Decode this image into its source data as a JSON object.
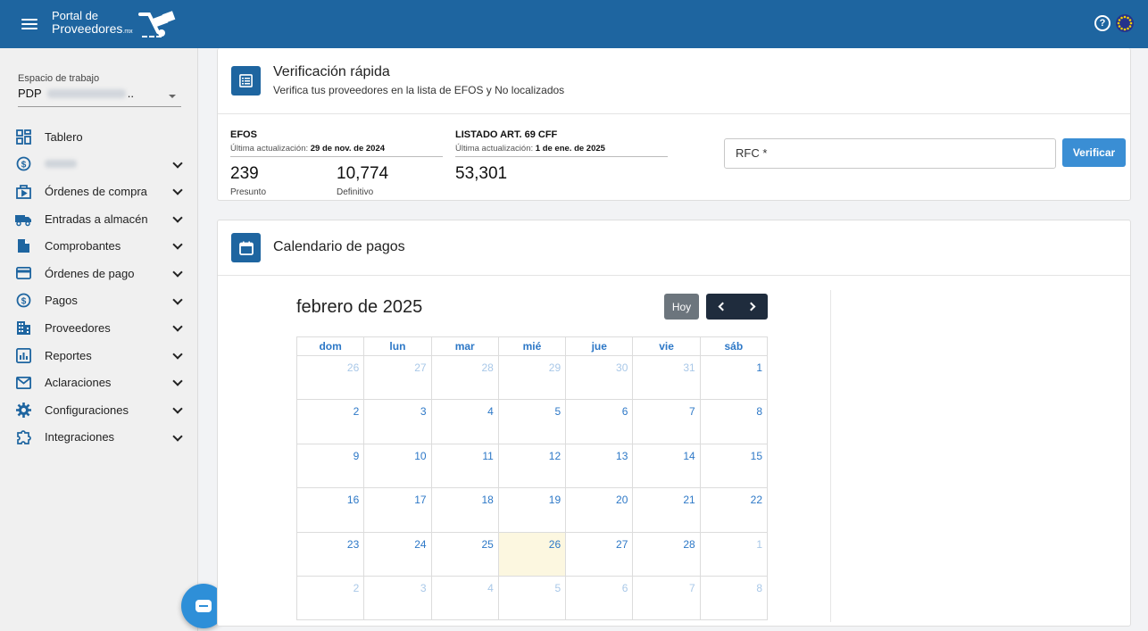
{
  "header": {
    "brand_line1": "Portal de",
    "brand_line2": "Proveedores",
    "brand_suffix": ".mx",
    "help_label": "?"
  },
  "sidebar": {
    "workspace_label": "Espacio de trabajo",
    "workspace_prefix": "PDP",
    "workspace_suffix": "..",
    "items": [
      {
        "label": "Tablero",
        "icon": "dashboard-icon",
        "chevron": false
      },
      {
        "label": "",
        "icon": "dollar-circle-icon",
        "chevron": true,
        "blurred": true
      },
      {
        "label": "Órdenes de compra",
        "icon": "purchase-order-icon",
        "chevron": true
      },
      {
        "label": "Entradas a almacén",
        "icon": "truck-icon",
        "chevron": true
      },
      {
        "label": "Comprobantes",
        "icon": "document-icon",
        "chevron": true
      },
      {
        "label": "Órdenes de pago",
        "icon": "credit-card-icon",
        "chevron": true
      },
      {
        "label": "Pagos",
        "icon": "dollar-circle-icon",
        "chevron": true
      },
      {
        "label": "Proveedores",
        "icon": "building-icon",
        "chevron": true
      },
      {
        "label": "Reportes",
        "icon": "bar-chart-icon",
        "chevron": true
      },
      {
        "label": "Aclaraciones",
        "icon": "envelope-icon",
        "chevron": true
      },
      {
        "label": "Configuraciones",
        "icon": "gear-icon",
        "chevron": true
      },
      {
        "label": "Integraciones",
        "icon": "puzzle-icon",
        "chevron": true
      }
    ]
  },
  "verification": {
    "title": "Verificación rápida",
    "subtitle": "Verifica tus proveedores en la lista de EFOS y No localizados",
    "efos": {
      "title": "EFOS",
      "update_label": "Última actualización:",
      "update_date": "29 de nov. de 2024",
      "presunto_value": "239",
      "presunto_label": "Presunto",
      "definitivo_value": "10,774",
      "definitivo_label": "Definitivo"
    },
    "art69": {
      "title": "LISTADO ART. 69 CFF",
      "update_label": "Última actualización:",
      "update_date": "1 de ene. de 2025",
      "value": "53,301"
    },
    "rfc_placeholder": "RFC *",
    "verify_label": "Verificar"
  },
  "calendar": {
    "title": "Calendario de pagos",
    "month_title": "febrero de 2025",
    "today_label": "Hoy",
    "weekdays": [
      "dom",
      "lun",
      "mar",
      "mié",
      "jue",
      "vie",
      "sáb"
    ],
    "weeks": [
      [
        "26",
        "27",
        "28",
        "29",
        "30",
        "31",
        "1"
      ],
      [
        "2",
        "3",
        "4",
        "5",
        "6",
        "7",
        "8"
      ],
      [
        "9",
        "10",
        "11",
        "12",
        "13",
        "14",
        "15"
      ],
      [
        "16",
        "17",
        "18",
        "19",
        "20",
        "21",
        "22"
      ],
      [
        "23",
        "24",
        "25",
        "26",
        "27",
        "28",
        "1"
      ],
      [
        "2",
        "3",
        "4",
        "5",
        "6",
        "7",
        "8"
      ]
    ],
    "today": "26"
  },
  "colors": {
    "header_bg": "#1e65a0",
    "accent": "#2d78c7",
    "verify_button": "#3a8ed4",
    "today_highlight": "#fcf7e0"
  }
}
